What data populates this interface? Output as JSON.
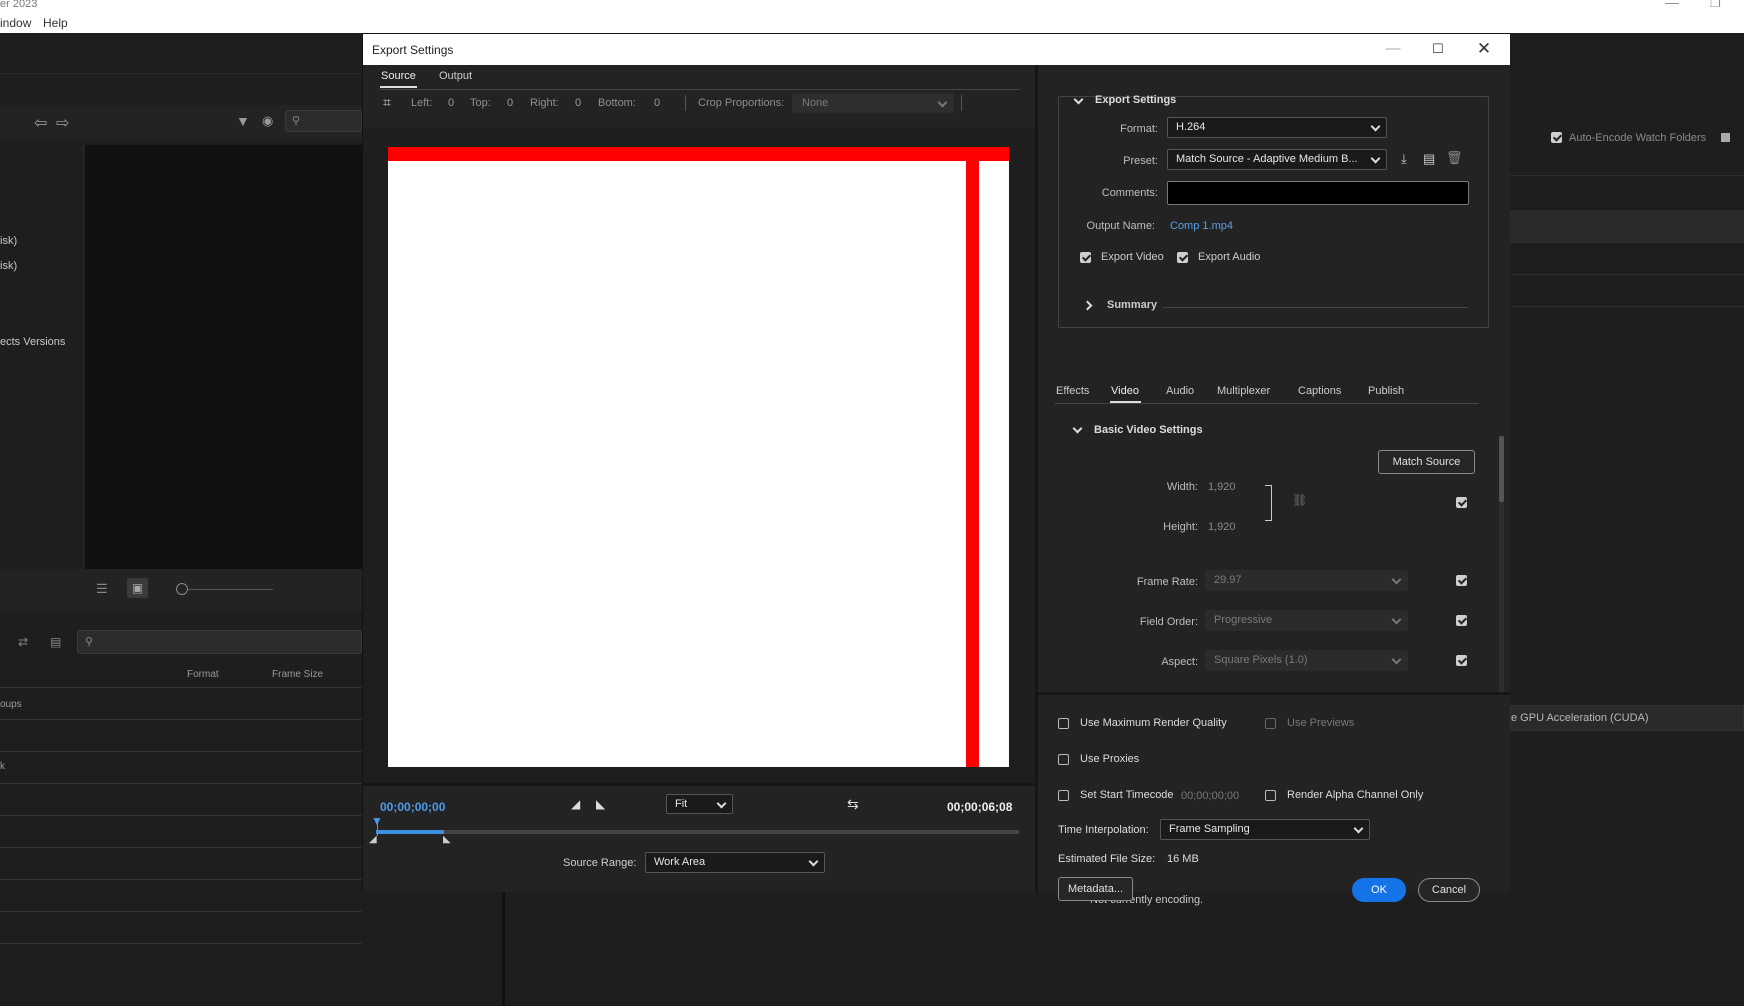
{
  "os_bar": {
    "app_name_fragment": "er 2023",
    "menu": [
      "indow",
      "Help"
    ]
  },
  "background": {
    "left_items": [
      "isk)",
      "isk)",
      "ects Versions"
    ],
    "list_groups": "oups",
    "col_format": "Format",
    "col_frame_size": "Frame Size",
    "fragment_k": "k",
    "auto_encode_label": "Auto-Encode Watch Folders",
    "gpu_label": "e GPU Acceleration (CUDA)",
    "encoding_status": "Not currently encoding."
  },
  "dialog": {
    "title": "Export Settings",
    "left_tabs": [
      {
        "label": "Source",
        "active": true
      },
      {
        "label": "Output",
        "active": false
      }
    ],
    "crop": {
      "left_label": "Left:",
      "left_val": "0",
      "top_label": "Top:",
      "top_val": "0",
      "right_label": "Right:",
      "right_val": "0",
      "bottom_label": "Bottom:",
      "bottom_val": "0",
      "proportions_label": "Crop Proportions:",
      "proportions_value": "None"
    },
    "timeline": {
      "current_time": "00;00;00;00",
      "end_time": "00;00;06;08",
      "zoom": "Fit",
      "source_range_label": "Source Range:",
      "source_range_value": "Work Area"
    },
    "export_settings": {
      "header": "Export Settings",
      "format_label": "Format:",
      "format_value": "H.264",
      "preset_label": "Preset:",
      "preset_value": "Match Source - Adaptive Medium B...",
      "comments_label": "Comments:",
      "comments_value": "",
      "output_name_label": "Output Name:",
      "output_name_value": "Comp 1.mp4",
      "export_video_label": "Export Video",
      "export_video": true,
      "export_audio_label": "Export Audio",
      "export_audio": true,
      "summary_label": "Summary"
    },
    "right_tabs": [
      {
        "label": "Effects",
        "active": false
      },
      {
        "label": "Video",
        "active": true
      },
      {
        "label": "Audio",
        "active": false
      },
      {
        "label": "Multiplexer",
        "active": false
      },
      {
        "label": "Captions",
        "active": false
      },
      {
        "label": "Publish",
        "active": false
      }
    ],
    "video": {
      "section": "Basic Video Settings",
      "match_source": "Match Source",
      "width_label": "Width:",
      "width_value": "1,920",
      "height_label": "Height:",
      "height_value": "1,920",
      "frame_rate_label": "Frame Rate:",
      "frame_rate_value": "29.97",
      "field_order_label": "Field Order:",
      "field_order_value": "Progressive",
      "aspect_label": "Aspect:",
      "aspect_value": "Square Pixels (1.0)"
    },
    "options": {
      "max_render_quality": "Use Maximum Render Quality",
      "use_previews": "Use Previews",
      "use_proxies": "Use Proxies",
      "set_start_timecode": "Set Start Timecode",
      "start_timecode_value": "00;00;00;00",
      "render_alpha": "Render Alpha Channel Only",
      "time_interp_label": "Time Interpolation:",
      "time_interp_value": "Frame Sampling",
      "est_size_label": "Estimated File Size:",
      "est_size_value": "16 MB"
    },
    "buttons": {
      "metadata": "Metadata...",
      "ok": "OK",
      "cancel": "Cancel"
    }
  },
  "colors": {
    "accent": "#1473e6",
    "frame_red": "#ff0000",
    "link": "#5aa0e6"
  }
}
